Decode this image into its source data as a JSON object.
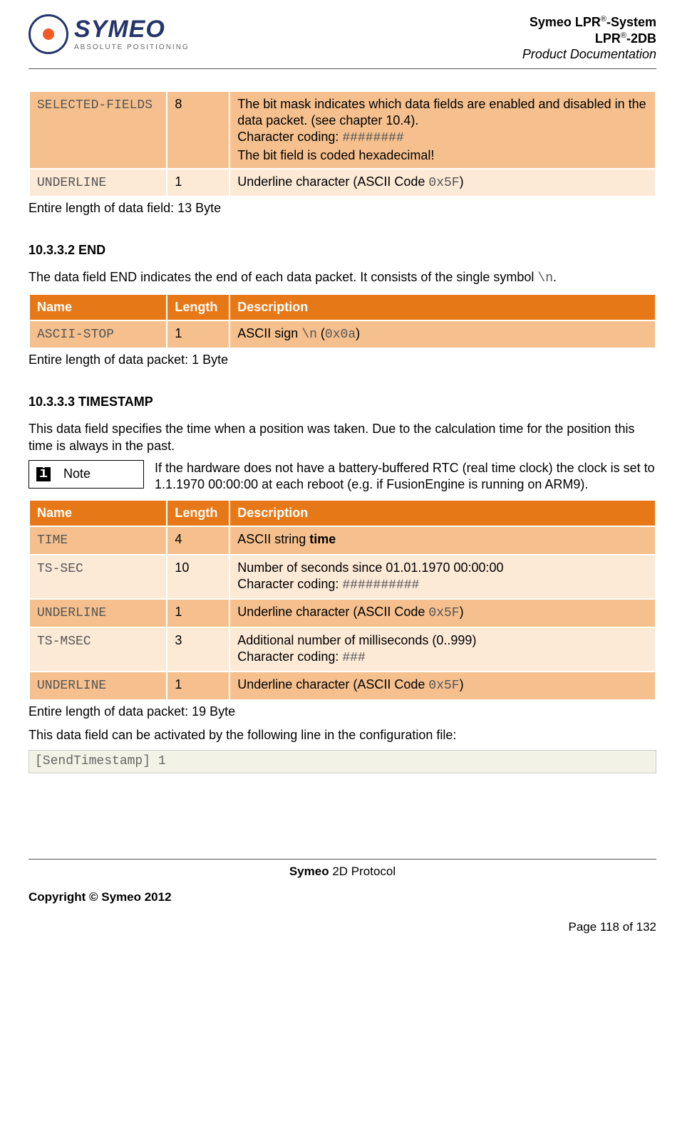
{
  "header": {
    "logo_main": "SYMEO",
    "logo_sub": "ABSOLUTE POSITIONING",
    "line1a": "Symeo LPR",
    "line1b": "-System",
    "line2a": "LPR",
    "line2b": "-2DB",
    "line3": "Product Documentation"
  },
  "table1": {
    "rows": [
      {
        "name": "SELECTED-FIELDS",
        "len": "8",
        "desc_l1": "The bit mask indicates which data fields are enabled and disabled in the data packet. (see chapter 10.4).",
        "desc_l2a": "Character coding: ",
        "desc_l2b": "########",
        "desc_l3": "The bit field is coded hexadecimal!",
        "shade": "dark"
      },
      {
        "name": "UNDERLINE",
        "len": "1",
        "desc_a": "Underline character (ASCII Code ",
        "desc_b": "0x5F",
        "desc_c": ")",
        "shade": "light"
      }
    ],
    "after": "Entire length of data field: 13 Byte"
  },
  "sect1": {
    "title": "10.3.3.2 END",
    "intro_a": "The data field END indicates the end of each data packet. It consists of the single symbol ",
    "intro_b": "\\n",
    "intro_c": "."
  },
  "table2": {
    "h1": "Name",
    "h2": "Length",
    "h3": "Description",
    "rows": [
      {
        "name": "ASCII-STOP",
        "len": "1",
        "desc_a": "ASCII sign ",
        "desc_b": "\\n",
        "desc_c": " (",
        "desc_d": "0x0a",
        "desc_e": ")",
        "shade": "dark"
      }
    ],
    "after": "Entire length of data packet: 1 Byte"
  },
  "sect2": {
    "title": "10.3.3.3 TIMESTAMP",
    "intro": "This data field specifies the time when a position was taken. Due to the calculation time for the position this time is always in the past.",
    "note_label": "Note",
    "note_text": "If the hardware does not have a battery-buffered RTC (real time clock) the clock is set to 1.1.1970 00:00:00 at each reboot (e.g. if FusionEngine is running on ARM9)."
  },
  "table3": {
    "h1": "Name",
    "h2": "Length",
    "h3": "Description",
    "rows": [
      {
        "name": "TIME",
        "len": "4",
        "desc_a": "ASCII string ",
        "desc_b": "time",
        "shade": "dark",
        "bold_b": true
      },
      {
        "name": "TS-SEC",
        "len": "10",
        "desc_l1": "Number of seconds since 01.01.1970 00:00:00",
        "desc_l2a": "Character coding: ",
        "desc_l2b": "##########",
        "shade": "light"
      },
      {
        "name": "UNDERLINE",
        "len": "1",
        "desc_a": "Underline character (ASCII Code ",
        "desc_b": "0x5F",
        "desc_c": ")",
        "shade": "dark"
      },
      {
        "name": "TS-MSEC",
        "len": "3",
        "desc_l1": "Additional number of milliseconds (0..999)",
        "desc_l2a": "Character coding: ",
        "desc_l2b": "###",
        "shade": "light"
      },
      {
        "name": "UNDERLINE",
        "len": "1",
        "desc_a": "Underline character (ASCII Code ",
        "desc_b": "0x5F",
        "desc_c": ")",
        "shade": "dark"
      }
    ],
    "after": "Entire length of data packet: 19 Byte",
    "config_intro": "This data field can be activated by the following line in the configuration file:",
    "config_line": "[SendTimestamp]  1"
  },
  "footer": {
    "center_a": "Symeo ",
    "center_b": "2D Protocol",
    "copy": "Copyright © Symeo 2012",
    "page": "Page 118 of 132"
  }
}
